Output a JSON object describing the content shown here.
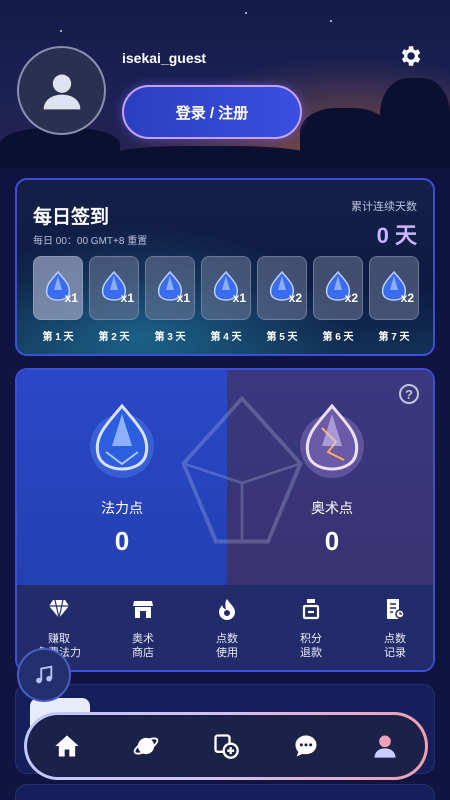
{
  "profile": {
    "username": "isekai_guest",
    "login_label": "登录 / 注册"
  },
  "checkin": {
    "title": "每日签到",
    "reset_note": "每日 00：00 GMT+8 重置",
    "streak_label": "累计连续天数",
    "streak_value": "0 天",
    "days": [
      {
        "label": "第 1 天",
        "reward": "x1"
      },
      {
        "label": "第 2 天",
        "reward": "x1"
      },
      {
        "label": "第 3 天",
        "reward": "x1"
      },
      {
        "label": "第 4 天",
        "reward": "x1"
      },
      {
        "label": "第 5 天",
        "reward": "x2"
      },
      {
        "label": "第 6 天",
        "reward": "x2"
      },
      {
        "label": "第 7 天",
        "reward": "x2"
      }
    ]
  },
  "points": {
    "help_icon": "?",
    "mana": {
      "name": "法力点",
      "value": "0"
    },
    "arcane": {
      "name": "奥术点",
      "value": "0"
    },
    "actions": [
      {
        "line1": "赚取",
        "line2": "免费法力",
        "icon": "gem-icon"
      },
      {
        "line1": "奥术",
        "line2": "商店",
        "icon": "shop-icon"
      },
      {
        "line1": "点数",
        "line2": "使用",
        "icon": "flame-icon"
      },
      {
        "line1": "积分",
        "line2": "退款",
        "icon": "refund-icon"
      },
      {
        "line1": "点数",
        "line2": "记录",
        "icon": "record-icon"
      }
    ]
  },
  "nav": {
    "items": [
      "home-icon",
      "planet-icon",
      "add-cards-icon",
      "chat-icon",
      "profile-icon"
    ]
  }
}
